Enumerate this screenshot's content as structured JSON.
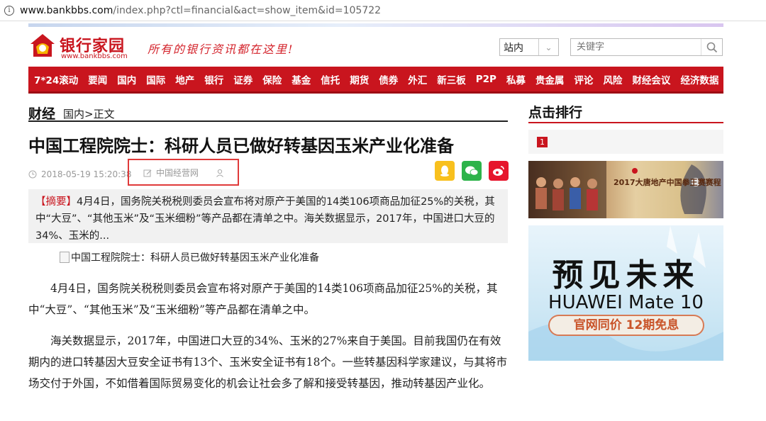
{
  "browser": {
    "url_host": "www.bankbbs.com",
    "url_path": "/index.php?ctl=financial&act=show_item&id=105722"
  },
  "logo": {
    "name": "银行家园",
    "url": "www.bankbbs.com",
    "slogan": "所有的银行资讯都在这里!"
  },
  "search": {
    "scope": "站内",
    "placeholder": "关键字"
  },
  "nav": [
    "7*24滚动",
    "要闻",
    "国内",
    "国际",
    "地产",
    "银行",
    "证券",
    "保险",
    "基金",
    "信托",
    "期货",
    "债券",
    "外汇",
    "新三板",
    "P2P",
    "私募",
    "贵金属",
    "评论",
    "风险",
    "财经会议",
    "经济数据"
  ],
  "section": {
    "name": "财经",
    "breadcrumb": "国内>正文"
  },
  "article": {
    "title": "中国工程院院士：科研人员已做好转基因玉米产业化准备",
    "datetime": "2018-05-19 15:20:38",
    "source": "中国经营网",
    "summary_tag": "【摘要】",
    "summary": "4月4日，国务院关税税则委员会宣布将对原产于美国的14类106项商品加征25%的关税，其中“大豆”、“其他玉米”及“玉米细粉”等产品都在清单之中。海关数据显示，2017年，中国进口大豆的34%、玉米的...",
    "image_alt": "中国工程院院士：科研人员已做好转基因玉米产业化准备",
    "paragraphs": [
      "4月4日，国务院关税税则委员会宣布将对原产于美国的14类106项商品加征25%的关税，其中“大豆”、“其他玉米”及“玉米细粉”等产品都在清单之中。",
      "海关数据显示，2017年，中国进口大豆的34%、玉米的27%来自于美国。目前我国仍在有效期内的进口转基因大豆安全证书有13个、玉米安全证书有18个。一些转基因科学家建议，与其将市场交付于外国，不如借着国际贸易变化的机会让社会多了解和接受转基因，推动转基因产业化。"
    ]
  },
  "share_icons": [
    "qq-icon",
    "wechat-icon",
    "weibo-icon"
  ],
  "sidebar": {
    "rank_title": "点击排行",
    "rank_first": "1",
    "ad1": {
      "title": "2017大唐地产中国拳王赛赛程"
    },
    "ad2": {
      "headline": "预见未来",
      "model": "HUAWEI Mate 10",
      "promo": "官网同价 12期免息"
    }
  },
  "colors": {
    "brand_red": "#c9151e",
    "nav_bg": "#c9151e"
  }
}
